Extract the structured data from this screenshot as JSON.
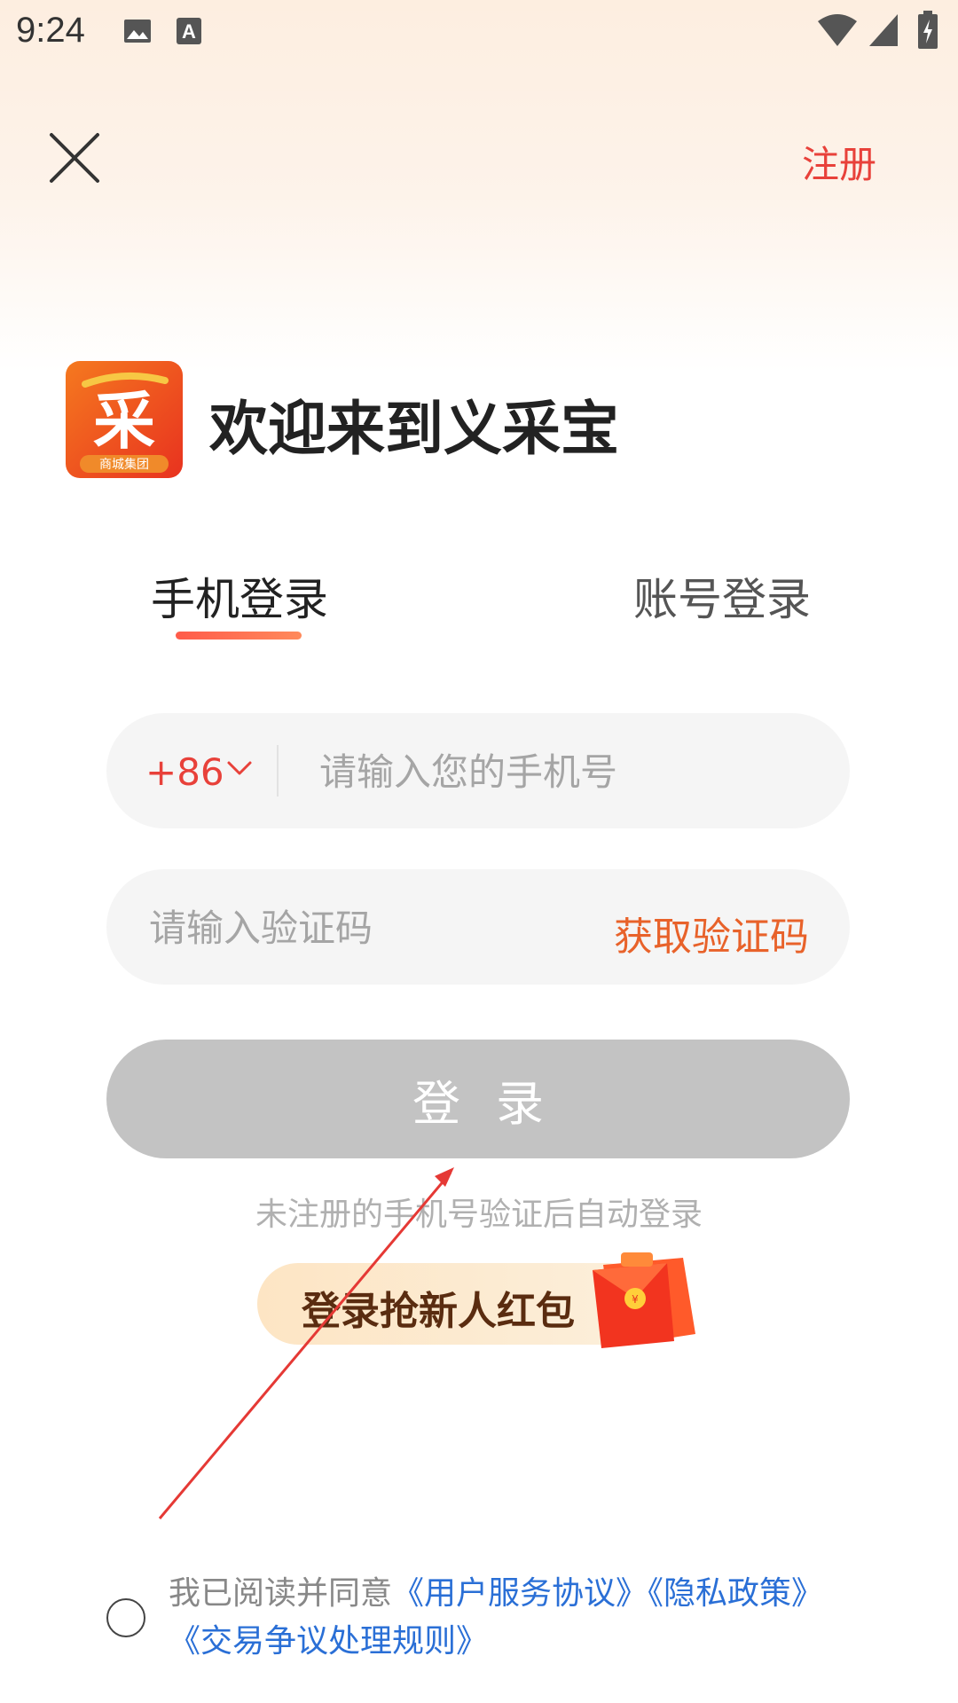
{
  "status_bar": {
    "time": "9:24",
    "icons": [
      "image-icon",
      "a-icon",
      "wifi-icon",
      "signal-icon",
      "battery-icon"
    ]
  },
  "top_bar": {
    "close_icon": "close-icon",
    "register_label": "注册"
  },
  "header": {
    "welcome": "欢迎来到义采宝",
    "logo_text": "采",
    "logo_subtext": "商城集团"
  },
  "tabs": [
    {
      "label": "手机登录",
      "active": true
    },
    {
      "label": "账号登录",
      "active": false
    }
  ],
  "phone_field": {
    "country_code": "+86",
    "placeholder": "请输入您的手机号",
    "value": ""
  },
  "code_field": {
    "placeholder": "请输入验证码",
    "value": "",
    "get_code_label": "获取验证码"
  },
  "login_button": {
    "label": "登录"
  },
  "auto_register_note": "未注册的手机号验证后自动登录",
  "promo": {
    "label": "登录抢新人红包",
    "icon": "red-packet-icon"
  },
  "agreement": {
    "checked": false,
    "prefix": "我已阅读并同意",
    "links": [
      "《用户服务协议》",
      "《隐私政策》",
      "《交易争议处理规则》"
    ]
  },
  "colors": {
    "accent": "#e8413a",
    "get_code": "#e8622a",
    "link": "#2a6fd6",
    "button_disabled": "#c3c3c3"
  }
}
